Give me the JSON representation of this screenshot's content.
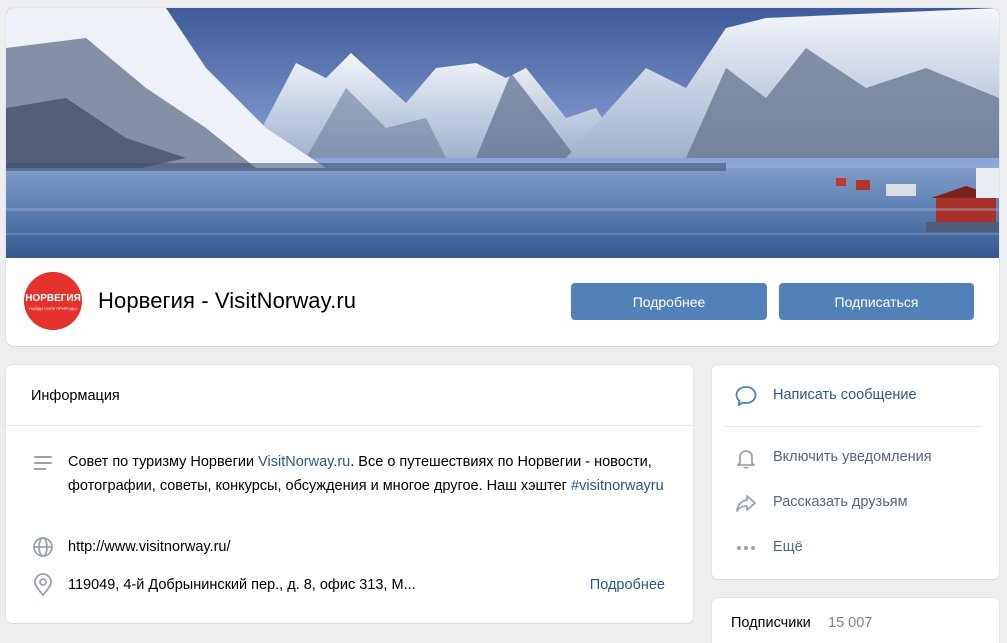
{
  "group": {
    "name": "Норвегия - VisitNorway.ru",
    "avatar_logo_text": "НОРВЕГИЯ",
    "avatar_logo_subtext": "НАЙДИ СИЛУ ПРИРОДЫ",
    "more_button": "Подробнее",
    "subscribe_button": "Подписаться"
  },
  "info": {
    "title": "Информация",
    "desc_before": "Совет по туризму Норвегии ",
    "desc_link": "VisitNorway.ru",
    "desc_after": ". Все о путешествиях по Норвегии - новости, фотографии, советы, конкурсы, обсуждения и многое другое. Наш хэштег ",
    "hashtag": "#visitnorwayru",
    "website": "http://www.visitnorway.ru/",
    "address": "119049, 4-й Добрынинский пер., д. 8, офис 313, М...",
    "address_more": "Подробнее"
  },
  "actions": {
    "message": "Написать сообщение",
    "notify": "Включить уведомления",
    "share": "Рассказать друзьям",
    "more": "Ещё"
  },
  "subscribers": {
    "title": "Подписчики",
    "count": "15 007"
  },
  "colors": {
    "accent": "#5181b8",
    "link": "#2a5885",
    "avatar_red": "#e5322d",
    "background": "#edeef0"
  }
}
